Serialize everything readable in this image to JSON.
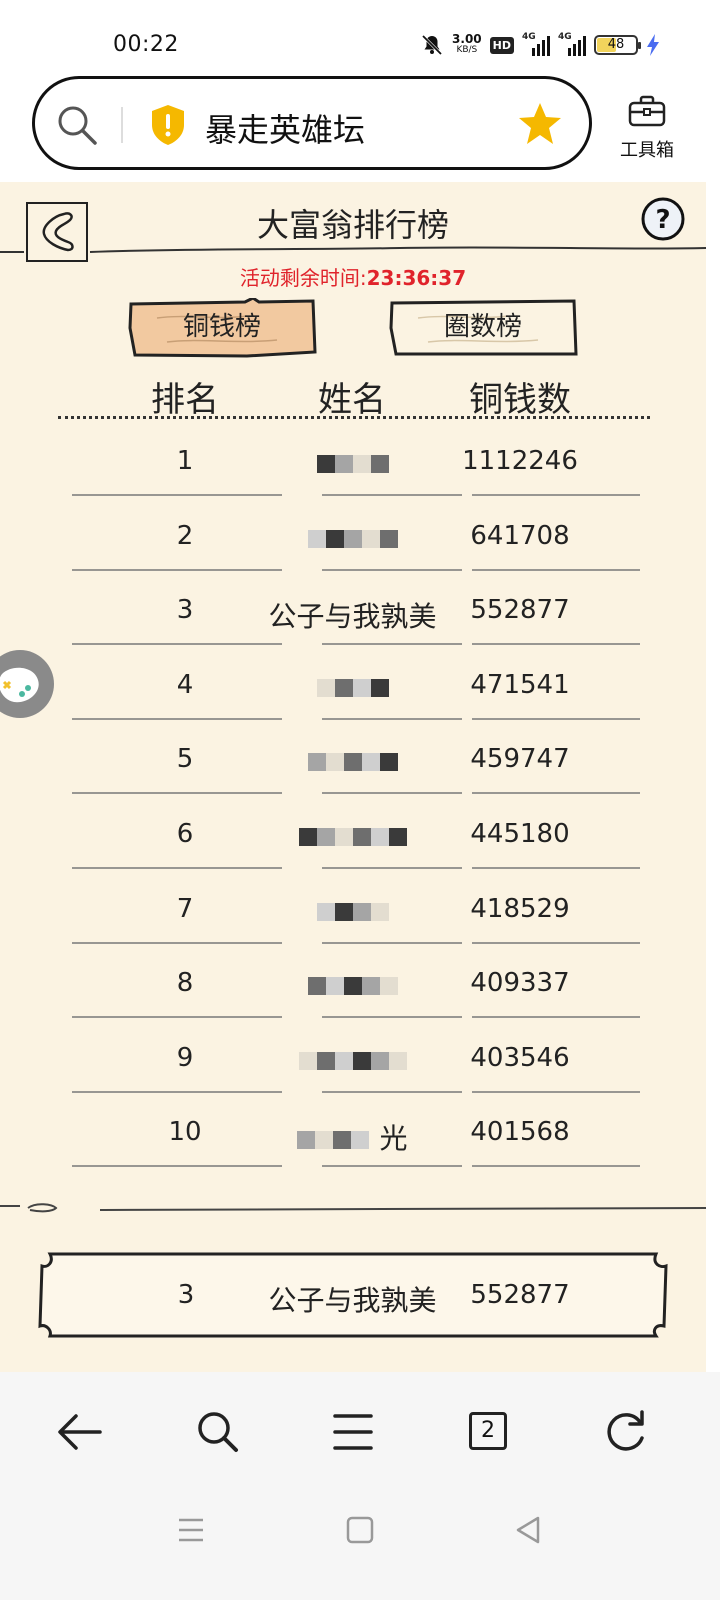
{
  "status_bar": {
    "time": "00:22",
    "speed_value": "3.00",
    "speed_unit": "KB/S",
    "hd_label": "HD",
    "network_1": "4G",
    "network_2": "4G",
    "battery": "48",
    "battery_level": 0.48
  },
  "address_bar": {
    "site_title": "暴走英雄坛",
    "toolbox_label": "工具箱"
  },
  "game": {
    "title": "大富翁排行榜",
    "countdown_label": "活动剩余时间:",
    "countdown_value": "23:36:37",
    "tabs": [
      {
        "label": "铜钱榜",
        "active": true
      },
      {
        "label": "圈数榜",
        "active": false
      }
    ],
    "columns": {
      "rank": "排名",
      "name": "姓名",
      "coins": "铜钱数"
    },
    "rows": [
      {
        "rank": "1",
        "name": "",
        "coins": "1112246"
      },
      {
        "rank": "2",
        "name": "",
        "coins": "641708"
      },
      {
        "rank": "3",
        "name": "公子与我孰美",
        "coins": "552877"
      },
      {
        "rank": "4",
        "name": "",
        "coins": "471541"
      },
      {
        "rank": "5",
        "name": "",
        "coins": "459747"
      },
      {
        "rank": "6",
        "name": "",
        "coins": "445180"
      },
      {
        "rank": "7",
        "name": "",
        "coins": "418529"
      },
      {
        "rank": "8",
        "name": "",
        "coins": "409337"
      },
      {
        "rank": "9",
        "name": "",
        "coins": "403546"
      },
      {
        "rank": "10",
        "name": "光",
        "coins": "401568"
      }
    ],
    "my_rank": {
      "rank": "3",
      "name": "公子与我孰美",
      "coins": "552877"
    }
  },
  "browser_toolbar": {
    "tab_count": "2"
  },
  "colors": {
    "game_background": "#fbf3e2",
    "active_tab": "#f2c9a0",
    "countdown": "#e0232b",
    "star": "#f5b800",
    "shield": "#f5b800"
  }
}
